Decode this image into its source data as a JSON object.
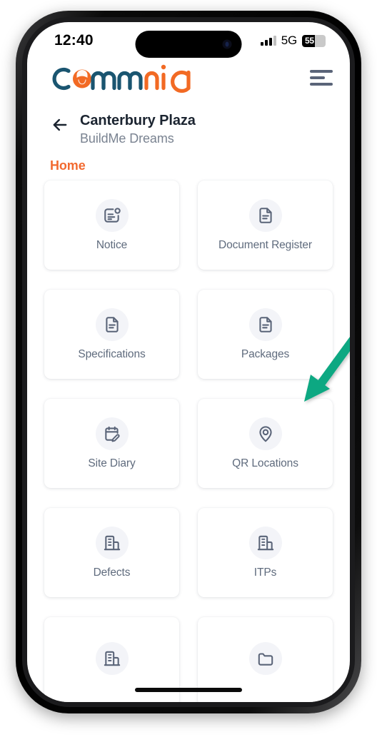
{
  "status_bar": {
    "time": "12:40",
    "network": "5G",
    "battery_percent": "55",
    "battery_level": 55,
    "signal_icon": "signal-bars-icon",
    "battery_icon": "battery-icon"
  },
  "app_bar": {
    "logo_text_part1": "c",
    "logo_text_part2": "mm",
    "logo_text_part3": "nia",
    "logo_alt": "commnia",
    "menu_icon": "hamburger-menu-icon"
  },
  "header": {
    "back_icon": "back-arrow-icon",
    "project_title": "Canterbury Plaza",
    "project_subtitle": "BuildMe Dreams",
    "section_label": "Home"
  },
  "annotation": {
    "type": "arrow",
    "color": "#11a882",
    "points_to": "Document Register"
  },
  "colors": {
    "brand_orange": "#f26a24",
    "brand_navy": "#1a5570",
    "accent_label": "#f26a30",
    "tile_label": "#5f6b7d",
    "tile_icon": "#5a6478",
    "tile_icon_bg": "#f3f4f8",
    "annotation_green": "#11a882"
  },
  "tiles": [
    {
      "label": "Notice",
      "icon": "notice-board-icon"
    },
    {
      "label": "Document Register",
      "icon": "document-icon"
    },
    {
      "label": "Specifications",
      "icon": "document-icon"
    },
    {
      "label": "Packages",
      "icon": "document-icon"
    },
    {
      "label": "Site Diary",
      "icon": "calendar-edit-icon"
    },
    {
      "label": "QR Locations",
      "icon": "map-pin-icon"
    },
    {
      "label": "Defects",
      "icon": "building-icon"
    },
    {
      "label": "ITPs",
      "icon": "building-icon"
    },
    {
      "label": "",
      "icon": "building-icon"
    },
    {
      "label": "",
      "icon": "folder-icon"
    }
  ]
}
